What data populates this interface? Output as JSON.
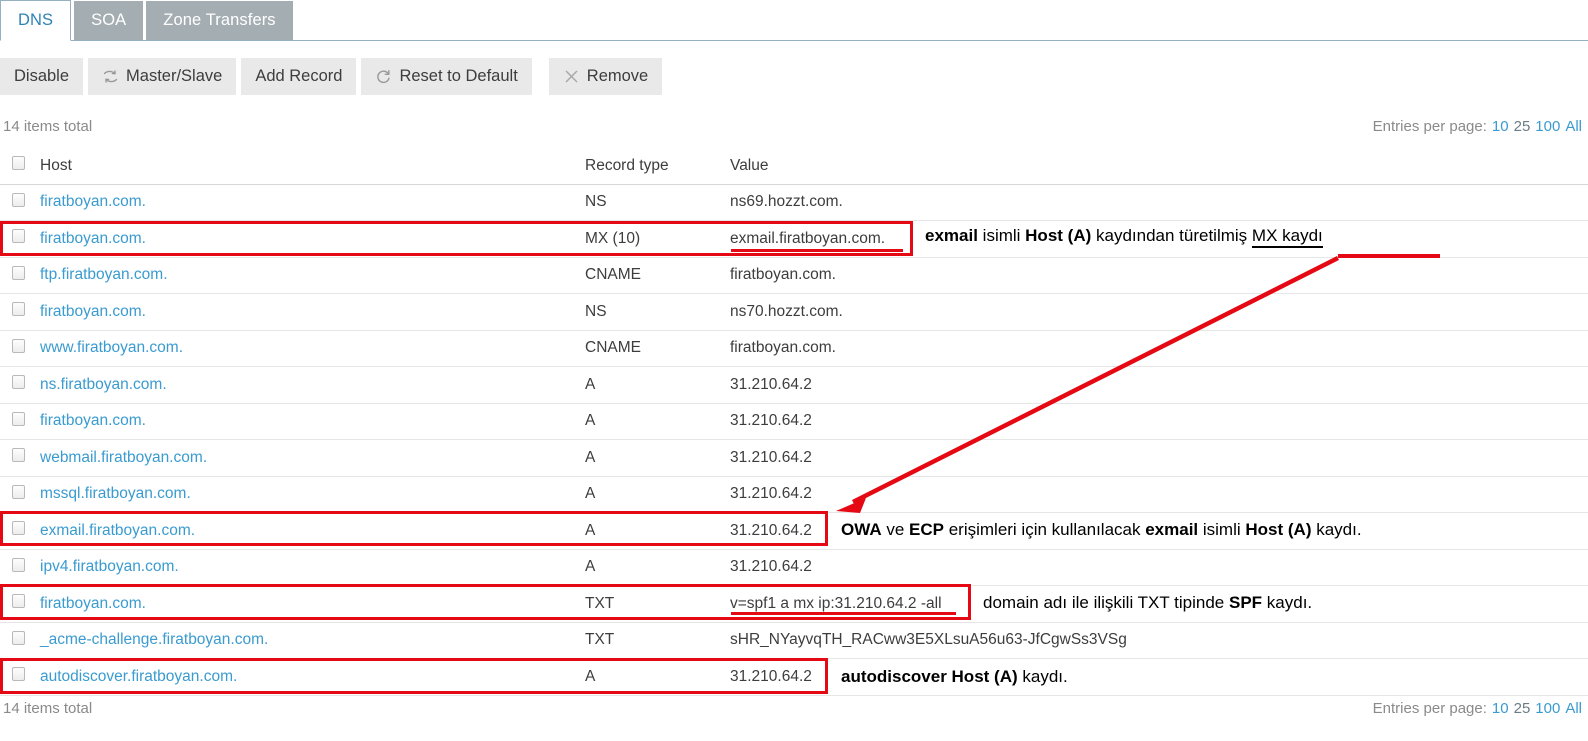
{
  "tabs": [
    {
      "label": "DNS",
      "active": true
    },
    {
      "label": "SOA",
      "active": false
    },
    {
      "label": "Zone Transfers",
      "active": false
    }
  ],
  "toolbar": [
    {
      "label": "Disable",
      "icon": "none"
    },
    {
      "label": "Master/Slave",
      "icon": "swap-icon"
    },
    {
      "label": "Add Record",
      "icon": "none"
    },
    {
      "label": "Reset to Default",
      "icon": "refresh-icon"
    },
    {
      "label": "Remove",
      "icon": "close-x-icon"
    }
  ],
  "list_meta": {
    "total_top": "14 items total",
    "total_bottom": "14 items total",
    "entries_label": "Entries per page:",
    "entries_options": [
      {
        "value": "10",
        "selected": false
      },
      {
        "value": "25",
        "selected": true
      },
      {
        "value": "100",
        "selected": false
      },
      {
        "value": "All",
        "selected": false
      }
    ]
  },
  "table": {
    "columns": [
      "Host",
      "Record type",
      "Value"
    ],
    "rows": [
      {
        "host": "firatboyan.com.",
        "type": "NS",
        "value": "ns69.hozzt.com."
      },
      {
        "host": "firatboyan.com.",
        "type": "MX (10)",
        "value": "exmail.firatboyan.com."
      },
      {
        "host": "ftp.firatboyan.com.",
        "type": "CNAME",
        "value": "firatboyan.com."
      },
      {
        "host": "firatboyan.com.",
        "type": "NS",
        "value": "ns70.hozzt.com."
      },
      {
        "host": "www.firatboyan.com.",
        "type": "CNAME",
        "value": "firatboyan.com."
      },
      {
        "host": "ns.firatboyan.com.",
        "type": "A",
        "value": "31.210.64.2"
      },
      {
        "host": "firatboyan.com.",
        "type": "A",
        "value": "31.210.64.2"
      },
      {
        "host": "webmail.firatboyan.com.",
        "type": "A",
        "value": "31.210.64.2"
      },
      {
        "host": "mssql.firatboyan.com.",
        "type": "A",
        "value": "31.210.64.2"
      },
      {
        "host": "exmail.firatboyan.com.",
        "type": "A",
        "value": "31.210.64.2"
      },
      {
        "host": "ipv4.firatboyan.com.",
        "type": "A",
        "value": "31.210.64.2"
      },
      {
        "host": "firatboyan.com.",
        "type": "TXT",
        "value": "v=spf1 a mx ip:31.210.64.2 -all"
      },
      {
        "host": "_acme-challenge.firatboyan.com.",
        "type": "TXT",
        "value": "sHR_NYayvqTH_RACww3E5XLsuA56u63-JfCgwSs3VSg"
      },
      {
        "host": "autodiscover.firatboyan.com.",
        "type": "A",
        "value": "31.210.64.2"
      }
    ]
  },
  "annotations": {
    "accent_color": "#e50914",
    "mx_note": {
      "part1_bold": "exmail",
      "part2": " isimli ",
      "part3_bold": "Host (A)",
      "part4": " kaydından türetilmiş ",
      "part5_underlined": "MX kaydı"
    },
    "exmail_note": {
      "part1_bold": "OWA",
      "part2": " ve ",
      "part3_bold": "ECP",
      "part4": " erişimleri için kullanılacak ",
      "part5_bold": "exmail",
      "part6": " isimli ",
      "part7_bold": "Host (A)",
      "part8": " kaydı."
    },
    "spf_note": {
      "part1": "domain adı ile ilişkili TXT tipinde ",
      "part2_bold": "SPF",
      "part3": " kaydı."
    },
    "autodiscover_note": {
      "part1_bold": "autodiscover Host (A)",
      "part2": " kaydı."
    }
  }
}
